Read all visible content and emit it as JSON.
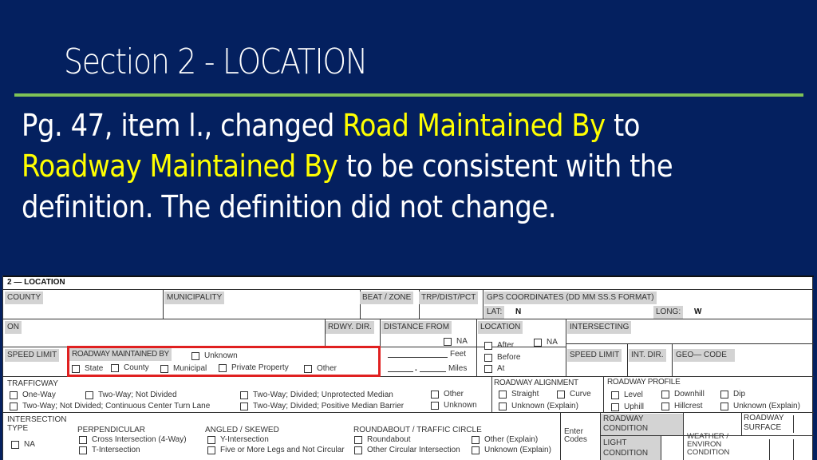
{
  "slide": {
    "title": "Section 2 - LOCATION",
    "body": {
      "part1": "Pg. 47, item l., changed ",
      "old_name": "Road Maintained By",
      "part2": " to ",
      "new_name": "Roadway Maintained By",
      "part3": " to be consistent with the definition. The definition did not change."
    },
    "colors": {
      "background": "#04205f",
      "accent_rule": "#7fc356",
      "highlight": "#ffff00",
      "red_outline": "#e02020"
    }
  },
  "form": {
    "section_title": "2 — LOCATION",
    "row1": {
      "county": "COUNTY",
      "municipality": "MUNICIPALITY",
      "beat_zone": "BEAT / ZONE",
      "trp": "TRP/DIST/PCT",
      "gps": "GPS COORDINATES (DD MM SS.S FORMAT)",
      "lat_label": "LAT:",
      "lat_value": "N",
      "long_label": "LONG:",
      "long_value": "W"
    },
    "row2": {
      "on": "ON",
      "rdwy_dir": "RDWY. DIR.",
      "distance_from": "DISTANCE FROM",
      "distance_na": "NA",
      "feet": "Feet",
      "miles": "Miles",
      "location": "LOCATION",
      "location_options": [
        "After",
        "Before",
        "At"
      ],
      "location_na": "NA",
      "intersecting": "INTERSECTING"
    },
    "row3": {
      "speed_limit": "SPEED LIMIT",
      "roadway_maintained_by": "ROADWAY MAINTAINED BY",
      "unknown": "Unknown",
      "maintained_options": [
        "State",
        "County",
        "Municipal",
        "Private Property",
        "Other"
      ],
      "speed_limit_2": "SPEED LIMIT",
      "int_dir": "INT. DIR.",
      "geo_code": "GEO— CODE"
    },
    "trafficway": {
      "label": "TRAFFICWAY",
      "options": [
        "One-Way",
        "Two-Way; Not Divided",
        "Two-Way; Divided; Unprotected Median",
        "Other",
        "Two-Way; Not Divided; Continuous Center Turn Lane",
        "Two-Way; Divided; Positive Median Barrier",
        "Unknown"
      ]
    },
    "alignment": {
      "label": "ROADWAY ALIGNMENT",
      "options": [
        "Straight",
        "Curve",
        "Unknown (Explain)"
      ]
    },
    "profile": {
      "label": "ROADWAY PROFILE",
      "options": [
        "Level",
        "Downhill",
        "Dip",
        "Uphill",
        "Hillcrest",
        "Unknown (Explain)"
      ]
    },
    "intersection": {
      "label_line1": "INTERSECTION",
      "label_line2": "TYPE",
      "na": "NA",
      "perpendicular": "PERPENDICULAR",
      "perpendicular_options": [
        "Cross Intersection (4-Way)",
        "T-Intersection"
      ],
      "angled": "ANGLED / SKEWED",
      "angled_options": [
        "Y-Intersection",
        "Five or More Legs and Not Circular"
      ],
      "roundabout": "ROUNDABOUT / TRAFFIC CIRCLE",
      "roundabout_options": [
        "Roundabout",
        "Other (Explain)",
        "Other Circular Intersection",
        "Unknown (Explain)"
      ]
    },
    "codes": {
      "enter_codes_1": "Enter",
      "enter_codes_2": "Codes",
      "roadway_condition_1": "ROADWAY",
      "roadway_condition_2": "CONDITION",
      "light_condition_1": "LIGHT",
      "light_condition_2": "CONDITION",
      "weather_1": "WEATHER /",
      "weather_2": "ENVIRON",
      "weather_3": "CONDITION",
      "roadway_surface_1": "ROADWAY",
      "roadway_surface_2": "SURFACE"
    }
  }
}
